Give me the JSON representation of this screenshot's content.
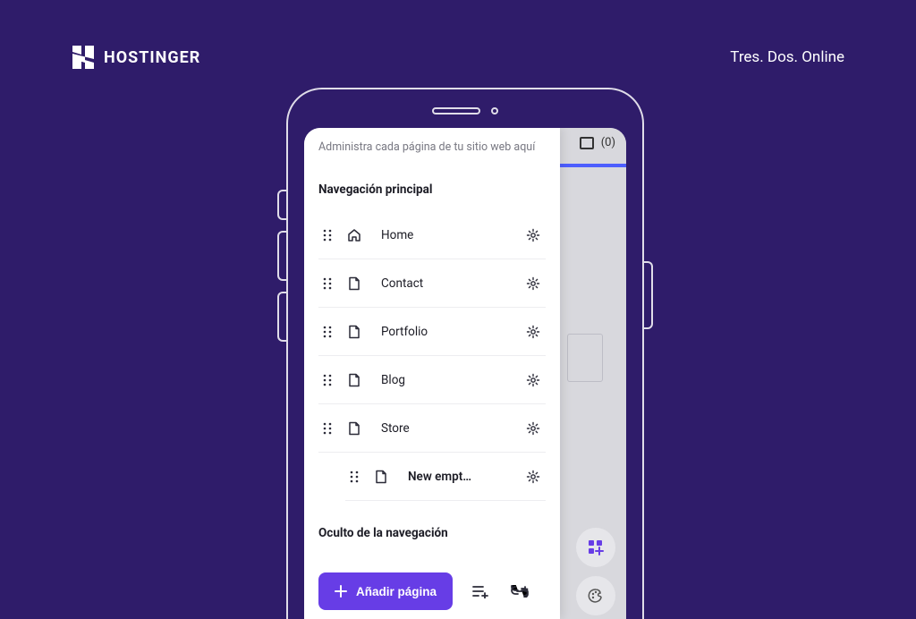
{
  "brand": "HOSTINGER",
  "tagline": "Tres. Dos. Online",
  "panel": {
    "hint": "Administra cada página de tu sitio web aquí",
    "section_main": "Navegación principal",
    "section_hidden": "Oculto de la navegación",
    "items": [
      {
        "label": "Home",
        "icon": "home"
      },
      {
        "label": "Contact",
        "icon": "page"
      },
      {
        "label": "Portfolio",
        "icon": "page"
      },
      {
        "label": "Blog",
        "icon": "page"
      },
      {
        "label": "Store",
        "icon": "page"
      }
    ],
    "child_item": {
      "label": "New empt…",
      "icon": "page"
    },
    "add_label": "Añadir página"
  },
  "bg": {
    "count": "(0)"
  }
}
